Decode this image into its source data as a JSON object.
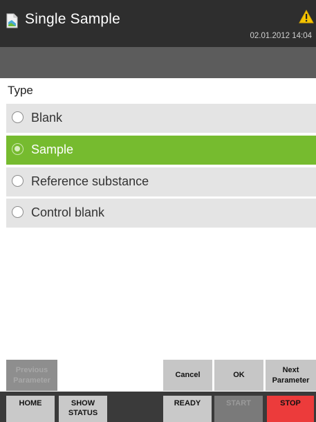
{
  "header": {
    "title": "Single Sample",
    "datetime": "02.01.2012 14:04",
    "app_icon": "document-icon",
    "status_icon": "warning-icon",
    "warning_color": "#f5c400"
  },
  "list": {
    "heading": "Type",
    "options": [
      {
        "label": "Blank",
        "selected": false
      },
      {
        "label": "Sample",
        "selected": true
      },
      {
        "label": "Reference substance",
        "selected": false
      },
      {
        "label": "Control blank",
        "selected": false
      }
    ],
    "selected_color": "#76bb2f"
  },
  "nav": {
    "previous_line1": "Previous",
    "previous_line2": "Parameter",
    "cancel": "Cancel",
    "ok": "OK",
    "next_line1": "Next",
    "next_line2": "Parameter"
  },
  "bottom": {
    "home": "HOME",
    "show_line1": "SHOW",
    "show_line2": "STATUS",
    "ready": "READY",
    "start": "START",
    "stop": "STOP",
    "stop_color": "#ec3b3b"
  }
}
